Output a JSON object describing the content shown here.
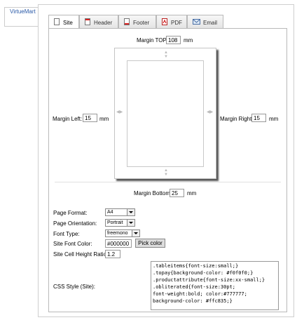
{
  "side_tab": {
    "label": "VirtueMart"
  },
  "tabs": [
    {
      "label": "Site"
    },
    {
      "label": "Header"
    },
    {
      "label": "Footer"
    },
    {
      "label": "PDF"
    },
    {
      "label": "Email"
    }
  ],
  "margins": {
    "top_label": "Margin TOP:",
    "top_value": "108",
    "left_label": "Margin Left:",
    "left_value": "15",
    "right_label": "Margin Right:",
    "right_value": "15",
    "bottom_label": "Margin Bottom:",
    "bottom_value": "25",
    "unit": "mm"
  },
  "settings": {
    "page_format_label": "Page Format:",
    "page_format_value": "A4",
    "orientation_label": "Page Orientation:",
    "orientation_value": "Portrait",
    "font_type_label": "Font Type:",
    "font_type_value": "freemono",
    "font_color_label": "Site Font Color:",
    "font_color_value": "#000000",
    "pick_color_label": "Pick color",
    "cell_ratio_label": "Site Cell Height Ratio:",
    "cell_ratio_value": "1.2",
    "css_label": "CSS Style (Site):",
    "css_value": ".tableitems{font-size:small;}\n.topay{background-color: #f0f0f0;}\n.productattribute{font-size:xx-small;}\n.obliterated{font-size:30pt;\nfont-weight:bold; color:#777777;\nbackground-color: #ffc835;}"
  }
}
